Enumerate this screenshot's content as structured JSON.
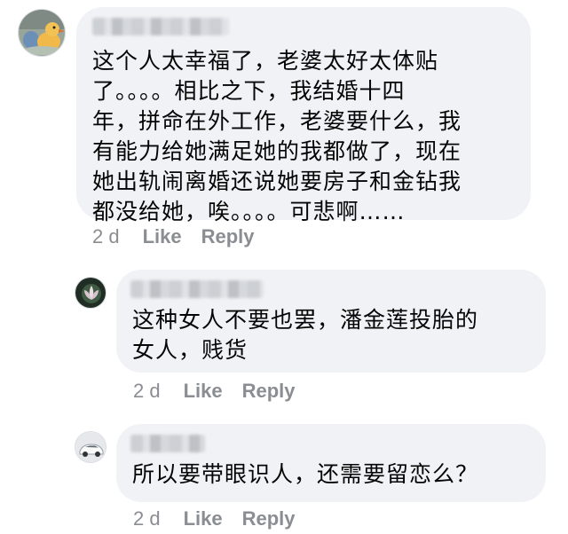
{
  "comments": [
    {
      "text": "这个人太幸福了，老婆太好太体贴\n了。。。。相比之下，我结婚十四\n年，拼命在外工作，老婆要什么，我\n有能力给她满足她的我都做了，现在\n她出轨闹离婚还说她要房子和金钻我\n都没给她，唉。。。。可悲啊……",
      "time": "2 d",
      "like": "Like",
      "reply": "Reply"
    },
    {
      "text": "这种女人不要也罢，潘金莲投胎的\n女人，贱货",
      "time": "2 d",
      "like": "Like",
      "reply": "Reply"
    },
    {
      "text": "所以要带眼识人，还需要留恋么？",
      "time": "2 d",
      "like": "Like",
      "reply": "Reply"
    }
  ],
  "colors": {
    "bubble": "#f0f2f5",
    "text": "#050505",
    "meta": "#8a8d91"
  }
}
